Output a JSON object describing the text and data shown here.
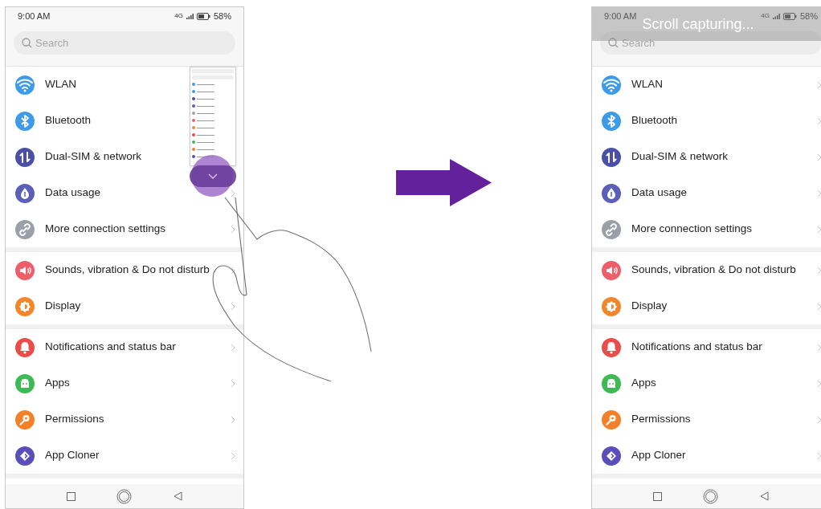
{
  "screens": [
    {
      "status_bar": {
        "time": "9:00 AM",
        "network": "4G",
        "battery": "58%"
      },
      "search": {
        "placeholder": "Search"
      },
      "gesture": true,
      "groups": [
        [
          {
            "label": "WLAN",
            "color": "#3d9be9"
          },
          {
            "label": "Bluetooth",
            "color": "#3d9be9"
          },
          {
            "label": "Dual-SIM & network",
            "color": "#4a4fa8"
          },
          {
            "label": "Data usage",
            "color": "#5b5fb8"
          },
          {
            "label": "More connection settings",
            "color": "#9aa0a8"
          }
        ],
        [
          {
            "label": "Sounds, vibration & Do not disturb",
            "color": "#ef5f6a"
          },
          {
            "label": "Display",
            "color": "#f3862b"
          }
        ],
        [
          {
            "label": "Notifications and status bar",
            "color": "#ec4b4b"
          },
          {
            "label": "Apps",
            "color": "#3dba54"
          },
          {
            "label": "Permissions",
            "color": "#f3812a"
          },
          {
            "label": "App Cloner",
            "color": "#5a4fb8"
          }
        ]
      ]
    },
    {
      "status_bar": {
        "time": "9:00 AM",
        "network": "4G",
        "battery": "58%"
      },
      "search": {
        "placeholder": "Search"
      },
      "gesture": false,
      "banner": "Scroll capturing...",
      "groups": [
        [
          {
            "label": "WLAN",
            "color": "#3d9be9"
          },
          {
            "label": "Bluetooth",
            "color": "#3d9be9"
          },
          {
            "label": "Dual-SIM & network",
            "color": "#4a4fa8"
          },
          {
            "label": "Data usage",
            "color": "#5b5fb8"
          },
          {
            "label": "More connection settings",
            "color": "#9aa0a8"
          }
        ],
        [
          {
            "label": "Sounds, vibration & Do not disturb",
            "color": "#ef5f6a"
          },
          {
            "label": "Display",
            "color": "#f3862b"
          }
        ],
        [
          {
            "label": "Notifications and status bar",
            "color": "#ec4b4b"
          },
          {
            "label": "Apps",
            "color": "#3dba54"
          },
          {
            "label": "Permissions",
            "color": "#f3812a"
          },
          {
            "label": "App Cloner",
            "color": "#5a4fb8"
          }
        ]
      ]
    }
  ]
}
